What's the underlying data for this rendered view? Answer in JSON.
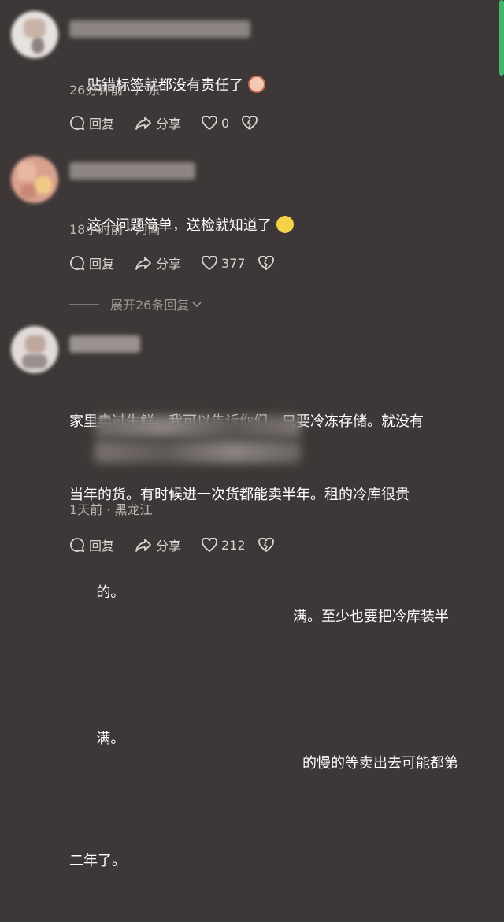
{
  "comments": [
    {
      "text": "贴错标签就都没有责任了",
      "time": "26分钟前",
      "location": "广东",
      "reply_label": "回复",
      "share_label": "分享",
      "likes": "0",
      "emoji": "shocked-face-emoji"
    },
    {
      "text": "这个问题简单，送检就知道了",
      "time": "18小时前",
      "location": "河南",
      "reply_label": "回复",
      "share_label": "分享",
      "likes": "377",
      "emoji": "thinking-face-emoji"
    },
    {
      "text_line1": "家里卖过生鲜。我可以告诉你们，只要冷冻存储。就没有",
      "text_line2": "当年的货。有时候进一次货都能卖半年。租的冷库很贵",
      "text_line3a": "的。",
      "text_line3b": "满。至少也要把冷库装半",
      "text_line4a": "满。",
      "text_line4b": "的慢的等卖出去可能都第",
      "text_line5": "二年了。",
      "time": "1天前",
      "location": "黑龙江",
      "reply_label": "回复",
      "share_label": "分享",
      "likes": "212"
    }
  ],
  "expand_replies": "展开26条回复",
  "meta_separator": "·",
  "colors": {
    "background": "#3d3837",
    "scrollbar": "#3fb86a"
  }
}
